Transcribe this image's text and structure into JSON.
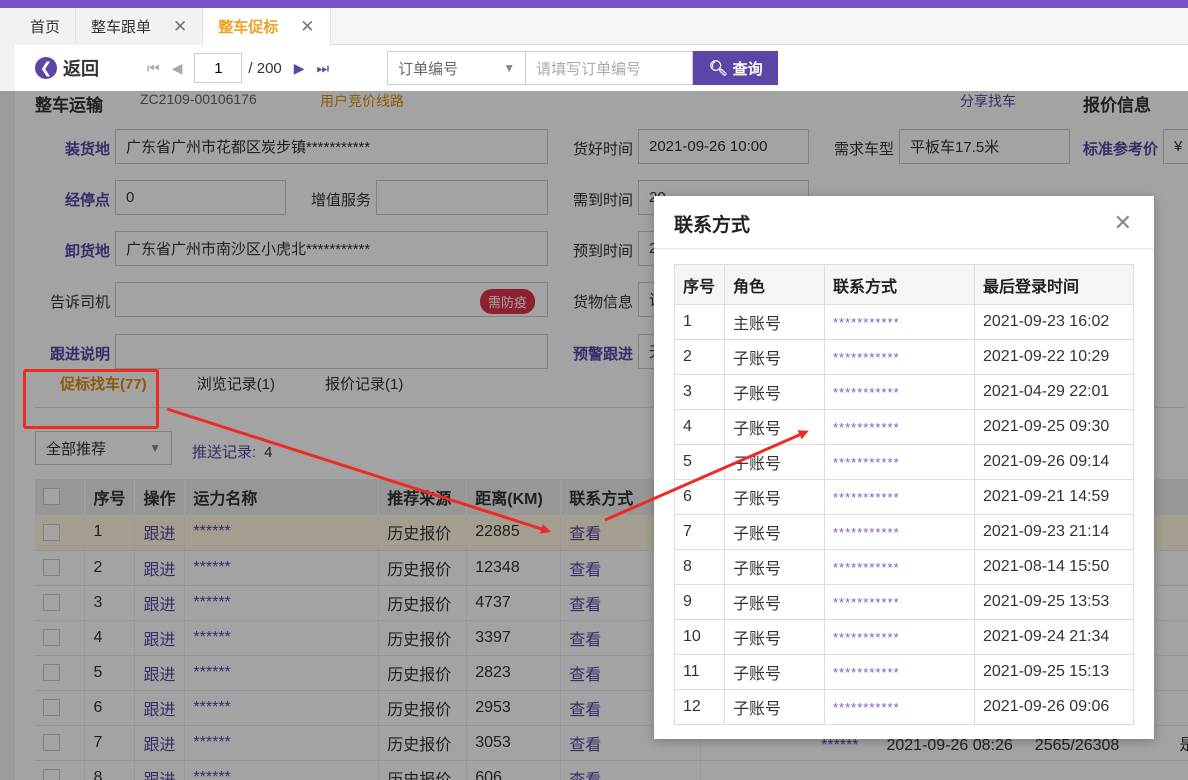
{
  "tabs": [
    {
      "label": "首页",
      "closable": false,
      "active": false
    },
    {
      "label": "整车跟单",
      "closable": true,
      "active": false
    },
    {
      "label": "整车促标",
      "closable": true,
      "active": true
    }
  ],
  "toolbar": {
    "back_label": "返回",
    "page_current": "1",
    "page_total": "/ 200",
    "search_type": "订单编号",
    "search_placeholder": "请填写订单编号",
    "query_label": "查询"
  },
  "section": {
    "title_left": "整车运输",
    "order_no": "ZC2109-00106176",
    "user_route": "用户竞价线路",
    "share": "分享找车",
    "title_right": "报价信息"
  },
  "form": {
    "load_label": "装货地",
    "load_value": "广东省广州市花都区炭步镇***********",
    "stop_label": "经停点",
    "stop_value": "0",
    "service_label": "增值服务",
    "service_value": "",
    "unload_label": "卸货地",
    "unload_value": "广东省广州市南沙区小虎北***********",
    "driver_label": "告诉司机",
    "driver_badge": "需防疫",
    "follow_label": "跟进说明",
    "ready_label": "货好时间",
    "ready_value": "2021-09-26 10:00",
    "need_label": "需到时间",
    "need_value": "20",
    "eta_label": "预到时间",
    "eta_value": "2",
    "goods_label": "货物信息",
    "goods_value": "请",
    "warn_label": "预警跟进",
    "warn_value": "无",
    "truck_label": "需求车型",
    "truck_value": "平板车17.5米",
    "ref_label": "标准参考价",
    "ref_value": "¥"
  },
  "subtabs": [
    {
      "label": "促标找车(77)",
      "active": true
    },
    {
      "label": "浏览记录(1)",
      "active": false
    },
    {
      "label": "报价记录(1)",
      "active": false
    }
  ],
  "filter": {
    "recommend": "全部推荐",
    "push_label": "推送记录:",
    "push_count": "4"
  },
  "grid": {
    "headers": [
      "",
      "序号",
      "操作",
      "运力名称",
      "推荐来源",
      "距离(KM)",
      "联系方式"
    ],
    "rows": [
      {
        "no": "1",
        "op": "跟进",
        "name": "******",
        "src": "历史报价",
        "dist": "22885",
        "contact": "查看"
      },
      {
        "no": "2",
        "op": "跟进",
        "name": "******",
        "src": "历史报价",
        "dist": "12348",
        "contact": "查看"
      },
      {
        "no": "3",
        "op": "跟进",
        "name": "******",
        "src": "历史报价",
        "dist": "4737",
        "contact": "查看"
      },
      {
        "no": "4",
        "op": "跟进",
        "name": "******",
        "src": "历史报价",
        "dist": "3397",
        "contact": "查看"
      },
      {
        "no": "5",
        "op": "跟进",
        "name": "******",
        "src": "历史报价",
        "dist": "2823",
        "contact": "查看"
      },
      {
        "no": "6",
        "op": "跟进",
        "name": "******",
        "src": "历史报价",
        "dist": "2953",
        "contact": "查看"
      },
      {
        "no": "7",
        "op": "跟进",
        "name": "******",
        "src": "历史报价",
        "dist": "3053",
        "contact": "查看"
      },
      {
        "no": "8",
        "op": "跟进",
        "name": "******",
        "src": "历史报价",
        "dist": "606",
        "contact": "查看"
      }
    ],
    "extra_row7": {
      "name2": "******",
      "date": "2021-09-26 08:26",
      "ratio": "2565/26308",
      "flag": "是"
    }
  },
  "modal": {
    "title": "联系方式",
    "headers": [
      "序号",
      "角色",
      "联系方式",
      "最后登录时间"
    ],
    "rows": [
      [
        "1",
        "主账号",
        "***********",
        "2021-09-23 16:02"
      ],
      [
        "2",
        "子账号",
        "***********",
        "2021-09-22 10:29"
      ],
      [
        "3",
        "子账号",
        "***********",
        "2021-04-29 22:01"
      ],
      [
        "4",
        "子账号",
        "***********",
        "2021-09-25 09:30"
      ],
      [
        "5",
        "子账号",
        "***********",
        "2021-09-26 09:14"
      ],
      [
        "6",
        "子账号",
        "***********",
        "2021-09-21 14:59"
      ],
      [
        "7",
        "子账号",
        "***********",
        "2021-09-23 21:14"
      ],
      [
        "8",
        "子账号",
        "***********",
        "2021-08-14 15:50"
      ],
      [
        "9",
        "子账号",
        "***********",
        "2021-09-25 13:53"
      ],
      [
        "10",
        "子账号",
        "***********",
        "2021-09-24 21:34"
      ],
      [
        "11",
        "子账号",
        "***********",
        "2021-09-25 15:13"
      ],
      [
        "12",
        "子账号",
        "***********",
        "2021-09-26 09:06"
      ]
    ]
  },
  "colors": {
    "brand": "#5b45a6",
    "active_tab": "#f0a020",
    "annotation_red": "#ee2a24"
  }
}
